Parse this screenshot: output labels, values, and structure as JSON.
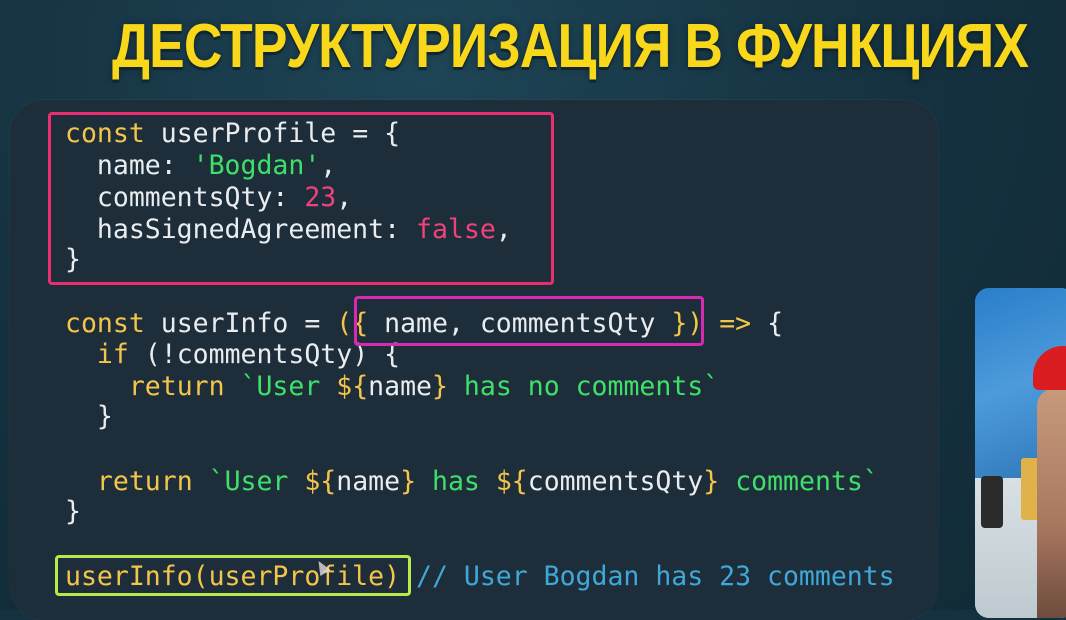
{
  "title": "ДЕСТРУКТУРИЗАЦИЯ В ФУНКЦИЯХ",
  "code": {
    "l1": {
      "kw": "const",
      "ident": " userProfile = ",
      "brace": "{"
    },
    "l2": {
      "key": "  name: ",
      "str": "'Bogdan'",
      "tail": ","
    },
    "l3": {
      "key": "  commentsQty: ",
      "num": "23",
      "tail": ","
    },
    "l4": {
      "key": "  hasSignedAgreement: ",
      "bool": "false",
      "tail": ","
    },
    "l5": {
      "close": "}"
    },
    "l6": {
      "kw": "const",
      "ident": " userInfo = ",
      "paren_open": "(",
      "brace_open": "{",
      "params": " name, commentsQty ",
      "brace_close": "}",
      "paren_close": ")",
      "arrow": " => ",
      "block_open": "{"
    },
    "l7": {
      "indent": "  ",
      "kw": "if",
      "rest": " (!commentsQty) ",
      "brace": "{"
    },
    "l8": {
      "indent": "    ",
      "kw": "return",
      "str_a": " `User ",
      "interp_open": "${",
      "var": "name",
      "interp_close": "}",
      "str_b": " has no comments`"
    },
    "l9": {
      "indent": "  ",
      "brace": "}"
    },
    "l10": {
      "indent": "  ",
      "kw": "return",
      "str_a": " `User ",
      "interp1_open": "${",
      "var1": "name",
      "interp1_close": "}",
      "str_b": " has ",
      "interp2_open": "${",
      "var2": "commentsQty",
      "interp2_close": "}",
      "str_c": " comments`"
    },
    "l11": {
      "close": "}"
    },
    "l12": {
      "call": "userInfo(userProfile)",
      "comment": " // User Bogdan has 23 comments"
    }
  },
  "colors": {
    "title": "#f9d81b",
    "keyword": "#f3c64a",
    "string": "#3ee06a",
    "number": "#f0427a",
    "comment": "#3fa8d8",
    "highlight_object": "#ea2e6f",
    "highlight_params": "#d829b4",
    "highlight_call": "#b8e94a"
  },
  "icons": {
    "cursor": "cursor-icon"
  }
}
